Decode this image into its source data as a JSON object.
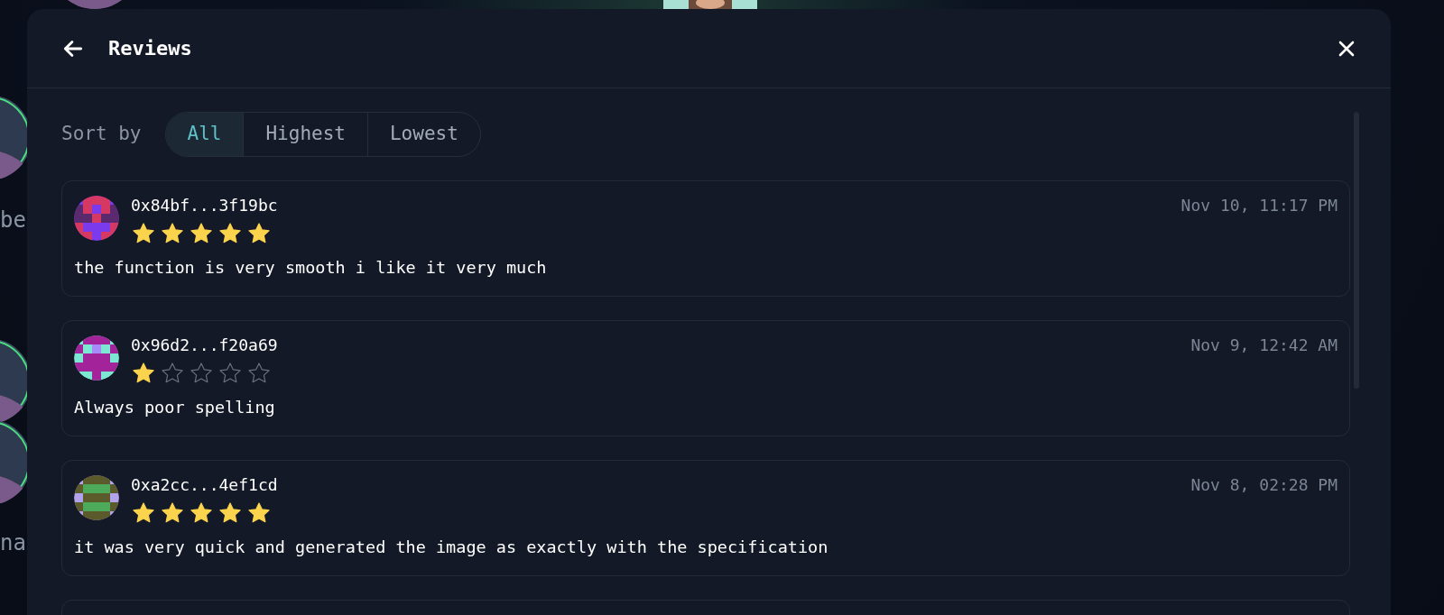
{
  "background": {
    "fragments": [
      "be",
      "na"
    ]
  },
  "dialog": {
    "title": "Reviews"
  },
  "sort": {
    "label": "Sort by",
    "options": [
      {
        "label": "All",
        "selected": true
      },
      {
        "label": "Highest",
        "selected": false
      },
      {
        "label": "Lowest",
        "selected": false
      }
    ]
  },
  "reviews": [
    {
      "address": "0x84bf...3f19bc",
      "stars": 5,
      "date": "Nov 10, 11:17 PM",
      "text": "the function is very smooth i like it very much"
    },
    {
      "address": "0x96d2...f20a69",
      "stars": 1,
      "date": "Nov 9, 12:42 AM",
      "text": "Always poor spelling"
    },
    {
      "address": "0xa2cc...4ef1cd",
      "stars": 5,
      "date": "Nov 8, 02:28 PM",
      "text": "it was very quick and generated the image as exactly with the specification"
    }
  ]
}
